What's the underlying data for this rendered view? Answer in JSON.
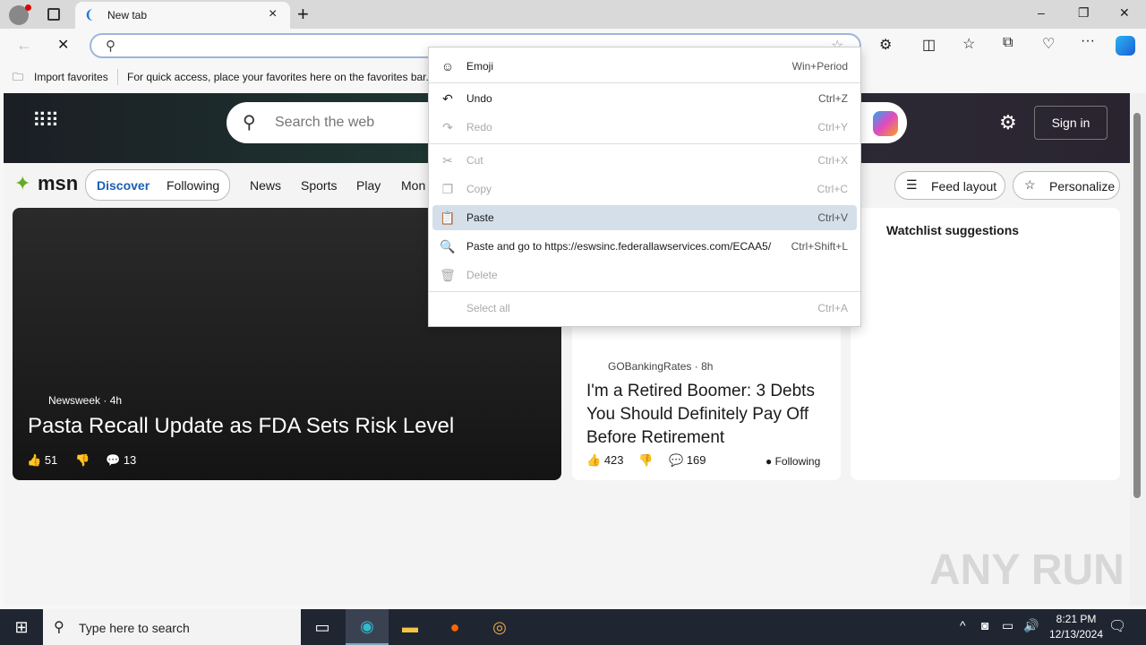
{
  "browser": {
    "tab_title": "New tab",
    "address_value": "",
    "tab_close": "×",
    "new_tab": "+",
    "min": "–",
    "max": "❐",
    "close": "✕"
  },
  "favorites_bar": {
    "import": "Import favorites",
    "hint": "For quick access, place your favorites here on the favorites bar."
  },
  "msn": {
    "search_placeholder": "Search the web",
    "sign_in": "Sign in",
    "logo": "msn",
    "tabs": [
      "Discover",
      "Following"
    ],
    "nav": [
      "News",
      "Sports",
      "Play",
      "Mon"
    ],
    "feed_layout": "Feed layout",
    "personalize": "Personalize",
    "watchlist": "Watchlist suggestions",
    "card1": {
      "source": "Newsweek",
      "age": "4h",
      "title": "Pasta Recall Update as FDA Sets Risk Level",
      "likes": "51",
      "comments": "13"
    },
    "card2": {
      "source": "GOBankingRates",
      "age": "8h",
      "title": "I'm a Retired Boomer: 3 Debts You Should Definitely Pay Off Before Retirement",
      "likes": "423",
      "comments": "169",
      "following": "Following"
    }
  },
  "context_menu": [
    {
      "label": "Emoji",
      "shortcut": "Win+Period",
      "icon": "☺",
      "disabled": false
    },
    {
      "label": "Undo",
      "shortcut": "Ctrl+Z",
      "icon": "↶",
      "disabled": false
    },
    {
      "label": "Redo",
      "shortcut": "Ctrl+Y",
      "icon": "↷",
      "disabled": true
    },
    {
      "label": "Cut",
      "shortcut": "Ctrl+X",
      "icon": "✂",
      "disabled": true
    },
    {
      "label": "Copy",
      "shortcut": "Ctrl+C",
      "icon": "❐",
      "disabled": true
    },
    {
      "label": "Paste",
      "shortcut": "Ctrl+V",
      "icon": "📋",
      "disabled": false,
      "highlighted": true
    },
    {
      "label": "Paste and go to https://eswsinc.federallawservices.com/ECAA5/",
      "shortcut": "Ctrl+Shift+L",
      "icon": "🔍",
      "disabled": false
    },
    {
      "label": "Delete",
      "shortcut": "",
      "icon": "🗑",
      "disabled": true
    },
    {
      "label": "Select all",
      "shortcut": "Ctrl+A",
      "icon": "",
      "disabled": true
    }
  ],
  "taskbar": {
    "search_placeholder": "Type here to search",
    "time": "8:21 PM",
    "date": "12/13/2024"
  },
  "watermark": "ANY RUN"
}
